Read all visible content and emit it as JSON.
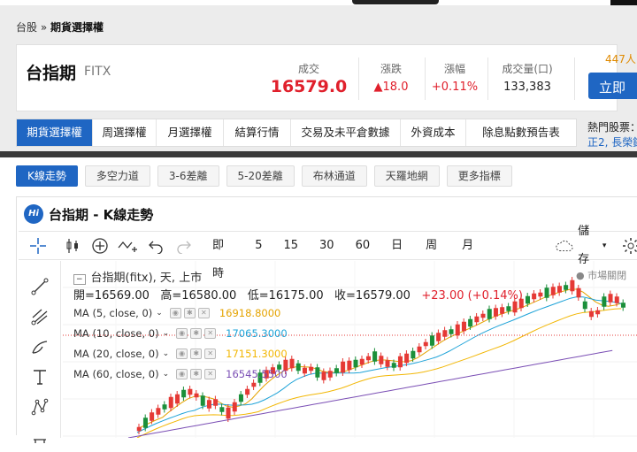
{
  "breadcrumb": {
    "home": "台股",
    "sep": "»",
    "current": "期貨選擇權"
  },
  "quote": {
    "name": "台指期",
    "code": "FITX",
    "stats": [
      {
        "label": "成交",
        "value": "16579.0"
      },
      {
        "label": "漲跌",
        "value": "▲18.0"
      },
      {
        "label": "漲幅",
        "value": "+0.11%"
      },
      {
        "label": "成交量(口)",
        "value": "133,383"
      }
    ],
    "people": "447人",
    "action": "立即"
  },
  "tabs": [
    "期貨選擇權",
    "周選擇權",
    "月選擇權",
    "結算行情",
    "交易及未平倉數據",
    "外資成本",
    "除息點數預告表"
  ],
  "hot": {
    "label": "熱門股票：",
    "links": "正2, 長榮鋼"
  },
  "chips": [
    "K線走勢",
    "多空力道",
    "3-6差離",
    "5-20差離",
    "布林通道",
    "天羅地網",
    "更多指標"
  ],
  "card": {
    "logo": "Hi",
    "title": "台指期 - K線走勢"
  },
  "toolbar": {
    "intervals": [
      "即時",
      "5",
      "15",
      "30",
      "60",
      "日",
      "周",
      "月"
    ],
    "save": "儲存"
  },
  "chart": {
    "legend": "台指期(fitx), 天, 上市",
    "market_status": "● 市場關閉",
    "ohlc": {
      "open": "開=16569.00",
      "high": "高=16580.00",
      "low": "低=16175.00",
      "close": "收=16579.00",
      "change": "+23.00 (+0.14%)"
    },
    "ma": [
      {
        "label": "MA (5, close, 0)",
        "value": "16918.8000",
        "color": "#e5a300"
      },
      {
        "label": "MA (10, close, 0)",
        "value": "17065.3000",
        "color": "#1ea3d8"
      },
      {
        "label": "MA (20, close, 0)",
        "value": "17151.3000",
        "color": "#f2b705"
      },
      {
        "label": "MA (60, close, 0)",
        "value": "16545.5500",
        "color": "#7b4fb5"
      }
    ]
  }
}
